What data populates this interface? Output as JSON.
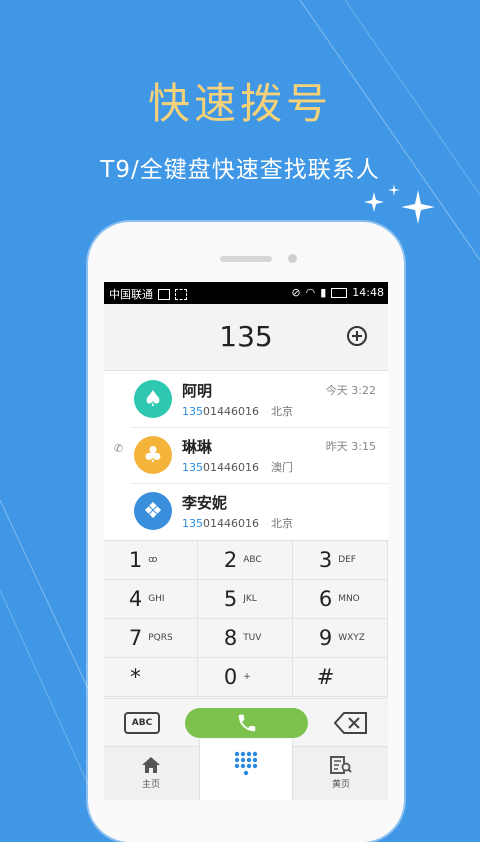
{
  "promo": {
    "title": "快速拨号",
    "subtitle": "T9/全键盘快速查找联系人"
  },
  "statusbar": {
    "carrier": "中国联通",
    "time": "14:48"
  },
  "dialer": {
    "number": "135"
  },
  "contacts": [
    {
      "name": "阿明",
      "num_match": "135",
      "num_rest": "01446016",
      "location": "北京",
      "time": "今天  3:22",
      "color": "#2ec7b0",
      "icon": "spade-icon",
      "glyph": "♠"
    },
    {
      "name": "琳琳",
      "num_match": "135",
      "num_rest": "01446016",
      "location": "澳门",
      "time": "昨天  3:15",
      "color": "#f4b43a",
      "icon": "club-icon",
      "glyph": "♣"
    },
    {
      "name": "李安妮",
      "num_match": "135",
      "num_rest": "01446016",
      "location": "北京",
      "time": "",
      "color": "#3a8fdc",
      "icon": "diamond-icon",
      "glyph": "❖"
    }
  ],
  "keys": [
    {
      "d": "1",
      "l": "ꝏ"
    },
    {
      "d": "2",
      "l": "ABC"
    },
    {
      "d": "3",
      "l": "DEF"
    },
    {
      "d": "4",
      "l": "GHI"
    },
    {
      "d": "5",
      "l": "JKL"
    },
    {
      "d": "6",
      "l": "MNO"
    },
    {
      "d": "7",
      "l": "PQRS"
    },
    {
      "d": "8",
      "l": "TUV"
    },
    {
      "d": "9",
      "l": "WXYZ"
    },
    {
      "d": "*",
      "l": ""
    },
    {
      "d": "0",
      "l": "+"
    },
    {
      "d": "#",
      "l": ""
    }
  ],
  "actions": {
    "abc_label": "ABC"
  },
  "tabs": [
    {
      "label": "主页"
    },
    {
      "label": ""
    },
    {
      "label": "黄页"
    }
  ],
  "colors": {
    "background": "#3f97e6",
    "accent_title": "#f5d27a",
    "call_button": "#7cc24d",
    "match_highlight": "#2a8be0"
  }
}
